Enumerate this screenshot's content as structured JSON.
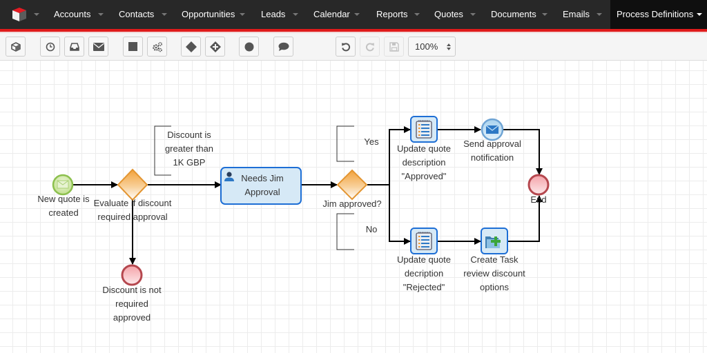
{
  "nav": {
    "logo": "suitecrm-logo-icon",
    "items": [
      {
        "label": "Accounts"
      },
      {
        "label": "Contacts"
      },
      {
        "label": "Opportunities"
      },
      {
        "label": "Leads"
      },
      {
        "label": "Calendar"
      },
      {
        "label": "Reports"
      },
      {
        "label": "Quotes"
      },
      {
        "label": "Documents"
      },
      {
        "label": "Emails"
      },
      {
        "label": "Process Definitions",
        "active": true
      }
    ],
    "colors": {
      "bar": "#282828",
      "active": "#0f0f0f",
      "accent": "#e01b1b"
    }
  },
  "toolbar": {
    "buttons": [
      {
        "name": "pool-tool",
        "icon": "cube-icon"
      },
      {
        "name": "timer-event-tool",
        "icon": "clock-icon"
      },
      {
        "name": "inbox-event-tool",
        "icon": "inbox-icon"
      },
      {
        "name": "message-event-tool",
        "icon": "envelope-icon"
      },
      {
        "name": "task-tool",
        "icon": "square-icon"
      },
      {
        "name": "settings-tool",
        "icon": "gears-icon"
      },
      {
        "name": "exclusive-gateway-tool",
        "icon": "diamond-icon"
      },
      {
        "name": "parallel-gateway-tool",
        "icon": "diamond-plus-icon"
      },
      {
        "name": "end-event-tool",
        "icon": "circle-icon"
      },
      {
        "name": "annotation-tool",
        "icon": "comment-icon"
      },
      {
        "name": "undo-button",
        "icon": "undo-icon"
      },
      {
        "name": "redo-button",
        "icon": "redo-icon",
        "disabled": true
      },
      {
        "name": "save-button",
        "icon": "save-icon",
        "disabled": true
      }
    ],
    "zoom": {
      "value": "100%"
    }
  },
  "diagram": {
    "start_event": {
      "label": [
        "New quote is",
        "created"
      ]
    },
    "gateway1": {
      "label": [
        "Evaluate if discount",
        "required approval"
      ]
    },
    "annotation1": {
      "text": [
        "Discount is",
        "greater than",
        "1K GBP"
      ]
    },
    "end_not_required": {
      "label": [
        "Discount is not",
        "required",
        "approved"
      ]
    },
    "task_jim": {
      "label": [
        "Needs Jim",
        "Approval"
      ]
    },
    "gateway2": {
      "label": "Jim approved?"
    },
    "annotation_yes": {
      "text": "Yes"
    },
    "annotation_no": {
      "text": "No"
    },
    "task_update_approved": {
      "label": [
        "Update quote",
        "description",
        "\"Approved\""
      ]
    },
    "event_send_notification": {
      "label": [
        "Send approval",
        "notification"
      ]
    },
    "task_update_rejected": {
      "label": [
        "Update quote",
        "decription",
        "\"Rejected\""
      ]
    },
    "task_create": {
      "label": [
        "Create Task",
        "review discount",
        "options"
      ]
    },
    "end_event": {
      "label": "End"
    },
    "colors": {
      "start_fill": "#d5ebb4",
      "start_stroke": "#8cc04e",
      "gateway_fill": "#f6b566",
      "gateway_stroke": "#e39531",
      "end_fill": "#f7b8bc",
      "end_stroke": "#b5474e",
      "task_fill": "#d6e9f6",
      "task_stroke": "#1d6ed5",
      "flow": "#000000"
    }
  }
}
